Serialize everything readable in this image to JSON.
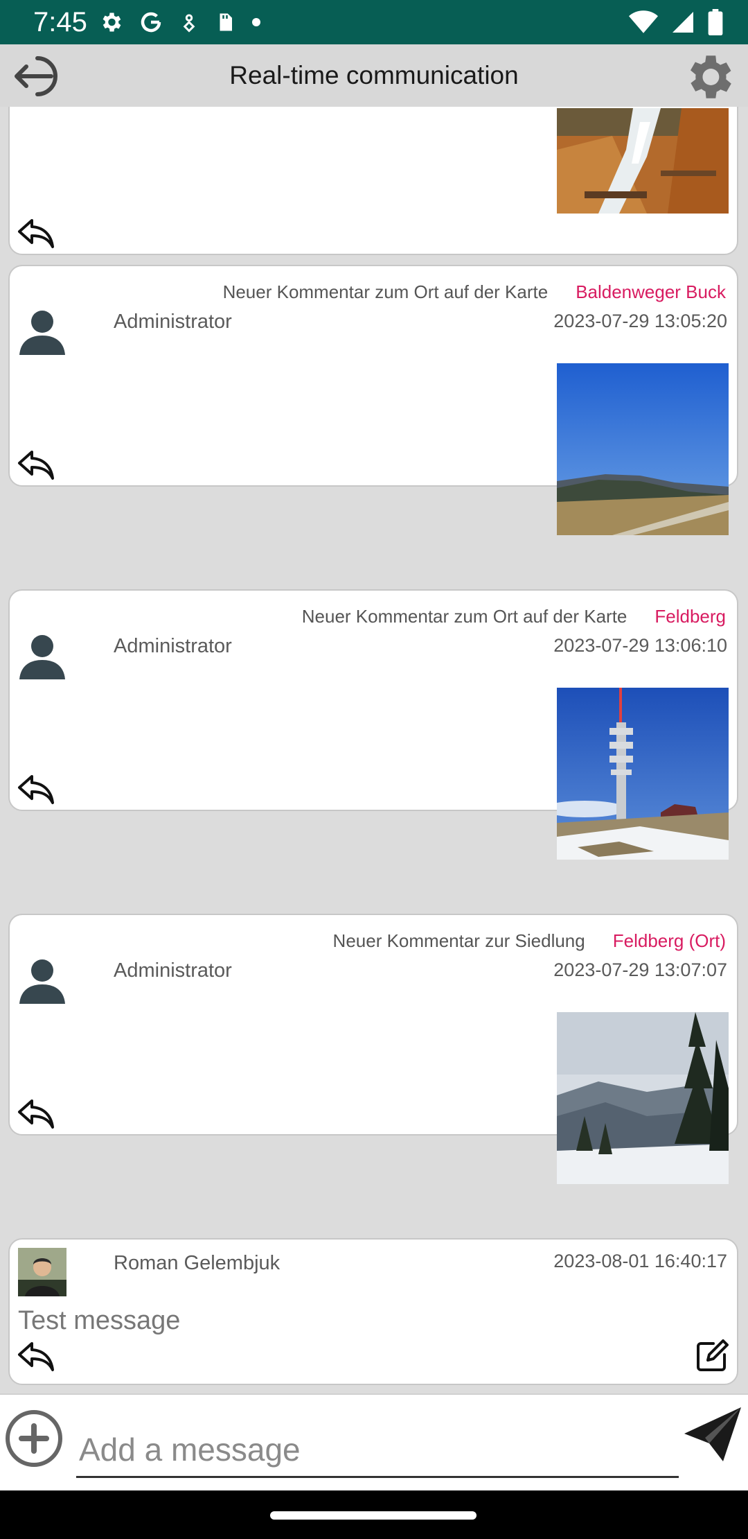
{
  "status_bar": {
    "time": "7:45",
    "icons_left": [
      "gear-icon",
      "google-icon",
      "location-sharing-icon",
      "sd-card-icon",
      "dot-icon"
    ],
    "icons_right": [
      "wifi-icon",
      "signal-icon",
      "battery-icon"
    ]
  },
  "app_bar": {
    "title": "Real-time communication"
  },
  "feed": {
    "cards": [
      {
        "photo_subject": "waterfall",
        "has_reply": true
      },
      {
        "caption": "Neuer Kommentar zum Ort auf der Karte",
        "place": "Baldenweger Buck",
        "author": "Administrator",
        "timestamp": "2023-07-29 13:05:20",
        "photo_subject": "mountain meadow view"
      },
      {
        "caption": "Neuer Kommentar zum Ort auf der Karte",
        "place": "Feldberg",
        "author": "Administrator",
        "timestamp": "2023-07-29 13:06:10",
        "photo_subject": "tv tower"
      },
      {
        "caption": "Neuer Kommentar zur Siedlung",
        "place": "Feldberg (Ort)",
        "author": "Administrator",
        "timestamp": "2023-07-29 13:07:07",
        "photo_subject": "winter valley"
      },
      {
        "author": "Roman Gelembjuk",
        "timestamp": "2023-08-01 16:40:17",
        "message": "Test message",
        "editable": true
      }
    ]
  },
  "composer": {
    "placeholder": "Add a message"
  },
  "colors": {
    "status_bar": "#075e54",
    "app_bar": "#d8d8d8",
    "place_link": "#d81b60",
    "avatar": "#37474f"
  }
}
